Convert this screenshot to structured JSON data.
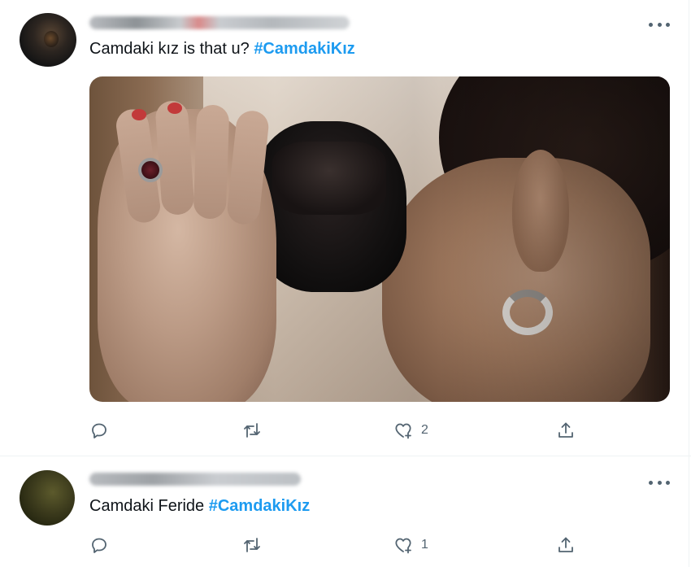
{
  "tweets": [
    {
      "text_plain": "Camdaki kız is that u? ",
      "hashtag": "#CamdakiKız",
      "like_count": "2",
      "has_media": true
    },
    {
      "text_plain": "Camdaki Feride ",
      "hashtag": "#CamdakiKız",
      "like_count": "1",
      "has_media": false
    }
  ],
  "icons": {
    "reply": "reply-icon",
    "retweet": "retweet-icon",
    "like": "like-icon",
    "share": "share-icon",
    "more": "more-icon"
  },
  "colors": {
    "hashtag": "#1d9bf0",
    "icon": "#536471",
    "text": "#0f1419",
    "divider": "#eff3f4"
  }
}
